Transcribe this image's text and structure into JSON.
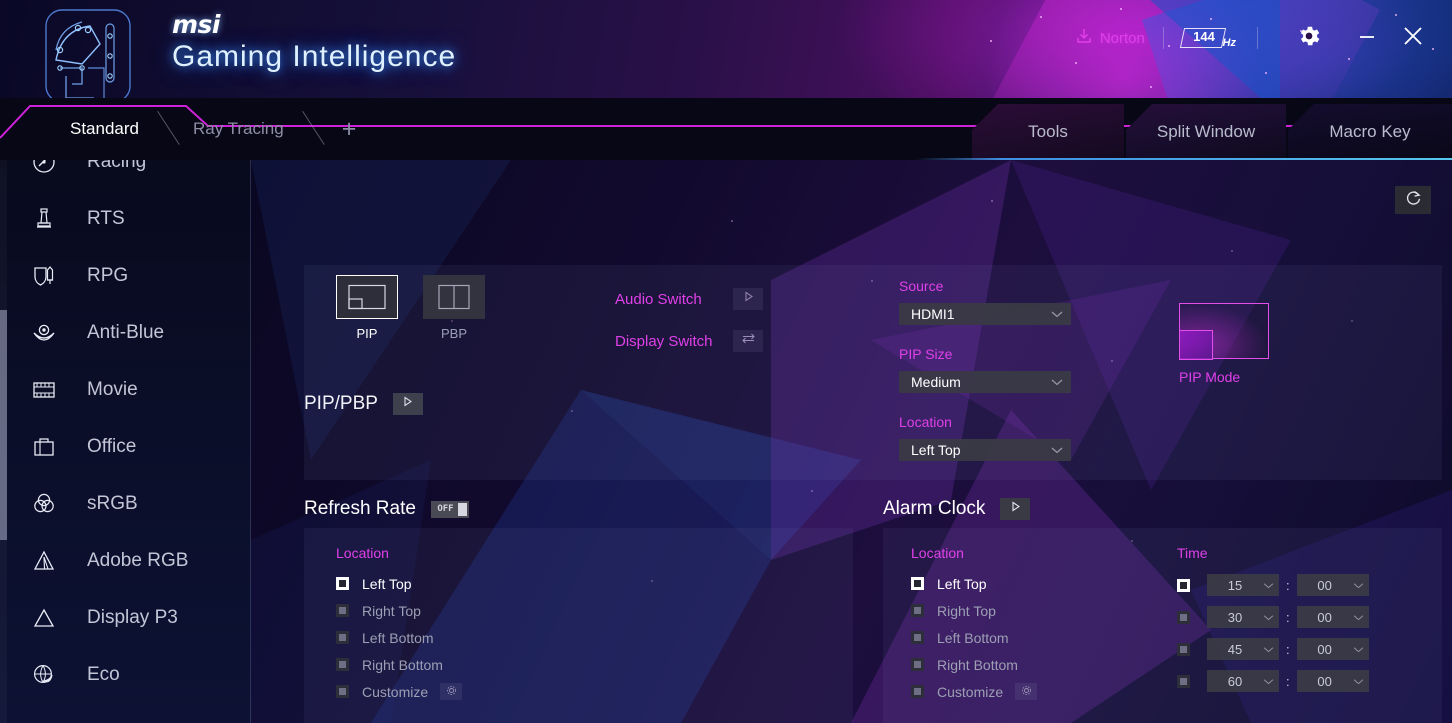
{
  "header": {
    "brand_msi": "msi",
    "brand_title": "Gaming Intelligence",
    "norton_label": "Norton",
    "refresh_rate_value": "144",
    "refresh_rate_unit": "Hz",
    "gear_icon": "gear-icon",
    "minimize_icon": "minimize-icon",
    "close_icon": "close-icon",
    "download_icon": "download-icon",
    "accent_magenta": "#e040e8",
    "accent_blue": "#57c8ee"
  },
  "tabs": {
    "profiles": [
      {
        "label": "Standard",
        "active": true
      },
      {
        "label": "Ray Tracing",
        "active": false
      }
    ],
    "add_label": "+",
    "right": [
      {
        "label": "Tools"
      },
      {
        "label": "Split Window"
      },
      {
        "label": "Macro Key"
      }
    ]
  },
  "sidebar": {
    "items": [
      {
        "label": "Racing",
        "icon": "speedometer-icon"
      },
      {
        "label": "RTS",
        "icon": "chess-rook-icon"
      },
      {
        "label": "RPG",
        "icon": "shield-sword-icon"
      },
      {
        "label": "Anti-Blue",
        "icon": "eye-care-icon"
      },
      {
        "label": "Movie",
        "icon": "film-strip-icon"
      },
      {
        "label": "Office",
        "icon": "briefcase-icon"
      },
      {
        "label": "sRGB",
        "icon": "color-circles-icon"
      },
      {
        "label": "Adobe RGB",
        "icon": "triangle-a-icon"
      },
      {
        "label": "Display P3",
        "icon": "triangle-icon"
      },
      {
        "label": "Eco",
        "icon": "globe-leaf-icon"
      }
    ]
  },
  "main": {
    "reset_icon": "reset-icon",
    "pip_pbp": {
      "title": "PIP/PBP",
      "play_icon": "play-icon",
      "modes": [
        {
          "label": "PIP",
          "selected": true,
          "icon": "pip-layout-icon"
        },
        {
          "label": "PBP",
          "selected": false,
          "icon": "pbp-layout-icon"
        }
      ],
      "switches": [
        {
          "label": "Audio Switch",
          "icon": "play-icon"
        },
        {
          "label": "Display Switch",
          "icon": "swap-arrows-icon"
        }
      ],
      "fields": [
        {
          "label": "Source",
          "value": "HDMI1"
        },
        {
          "label": "PIP Size",
          "value": "Medium"
        },
        {
          "label": "Location",
          "value": "Left Top"
        }
      ],
      "preview_caption": "PIP Mode"
    },
    "refresh_rate": {
      "title": "Refresh Rate",
      "toggle_label": "OFF",
      "toggle_on": false,
      "location_label": "Location",
      "options": [
        {
          "label": "Left Top",
          "selected": true
        },
        {
          "label": "Right Top",
          "selected": false
        },
        {
          "label": "Left Bottom",
          "selected": false
        },
        {
          "label": "Right Bottom",
          "selected": false
        },
        {
          "label": "Customize",
          "selected": false,
          "has_cog": true
        }
      ]
    },
    "alarm_clock": {
      "title": "Alarm Clock",
      "play_icon": "play-icon",
      "location_label": "Location",
      "options": [
        {
          "label": "Left Top",
          "selected": true
        },
        {
          "label": "Right Top",
          "selected": false
        },
        {
          "label": "Left Bottom",
          "selected": false
        },
        {
          "label": "Right Bottom",
          "selected": false
        },
        {
          "label": "Customize",
          "selected": false,
          "has_cog": true
        }
      ],
      "time_label": "Time",
      "times": [
        {
          "minutes": "15",
          "seconds": "00",
          "enabled": true
        },
        {
          "minutes": "30",
          "seconds": "00",
          "enabled": false
        },
        {
          "minutes": "45",
          "seconds": "00",
          "enabled": false
        },
        {
          "minutes": "60",
          "seconds": "00",
          "enabled": false
        }
      ]
    }
  }
}
